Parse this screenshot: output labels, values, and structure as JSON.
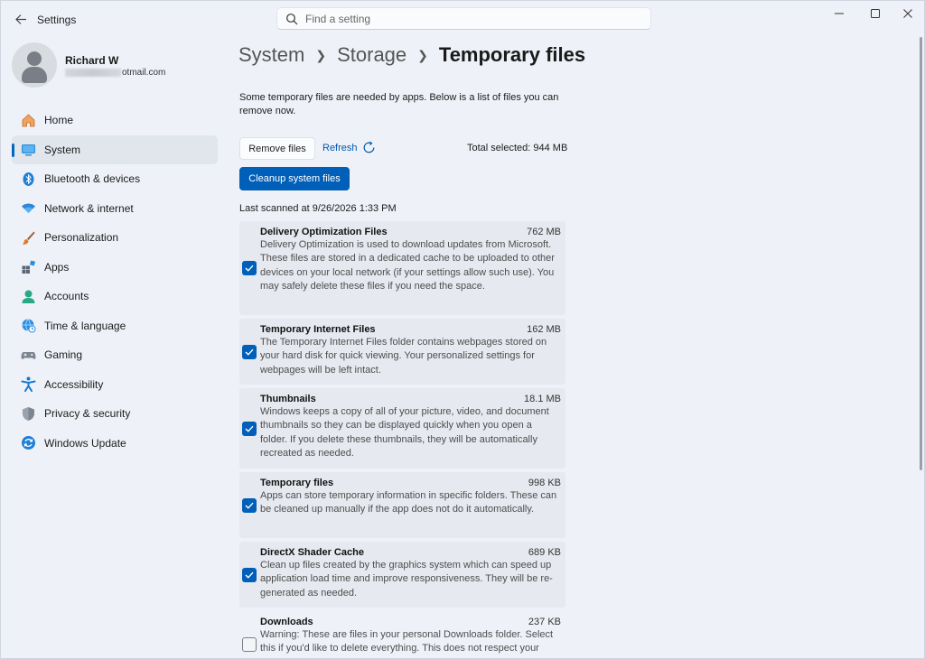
{
  "window": {
    "title": "Settings"
  },
  "search": {
    "placeholder": "Find a setting"
  },
  "user": {
    "name": "Richard W",
    "email_visible": "otmail.com"
  },
  "sidebar": {
    "items": [
      {
        "label": "Home",
        "icon": "home-icon"
      },
      {
        "label": "System",
        "icon": "system-icon",
        "active": true
      },
      {
        "label": "Bluetooth & devices",
        "icon": "bluetooth-icon"
      },
      {
        "label": "Network & internet",
        "icon": "wifi-icon"
      },
      {
        "label": "Personalization",
        "icon": "brush-icon"
      },
      {
        "label": "Apps",
        "icon": "apps-icon"
      },
      {
        "label": "Accounts",
        "icon": "accounts-icon"
      },
      {
        "label": "Time & language",
        "icon": "globe-clock-icon"
      },
      {
        "label": "Gaming",
        "icon": "gamepad-icon"
      },
      {
        "label": "Accessibility",
        "icon": "accessibility-icon"
      },
      {
        "label": "Privacy & security",
        "icon": "shield-icon"
      },
      {
        "label": "Windows Update",
        "icon": "update-icon"
      }
    ]
  },
  "breadcrumb": {
    "part1": "System",
    "part2": "Storage",
    "current": "Temporary files"
  },
  "intro": "Some temporary files are needed by apps. Below is a list of files you can remove now.",
  "actions": {
    "remove_label": "Remove files",
    "refresh_label": "Refresh",
    "total_selected": "Total selected: 944 MB",
    "cleanup_label": "Cleanup system files"
  },
  "last_scanned": "Last scanned at 9/26/2026 1:33 PM",
  "files": [
    {
      "name": "Delivery Optimization Files",
      "size": "762 MB",
      "checked": true,
      "desc": "Delivery Optimization is used to download updates from Microsoft. These files are stored in a dedicated cache to be uploaded to other devices on your local network (if your settings allow such use). You may safely delete these files if you need the space."
    },
    {
      "name": "Temporary Internet Files",
      "size": "162 MB",
      "checked": true,
      "desc": "The Temporary Internet Files folder contains webpages stored on your hard disk for quick viewing. Your personalized settings for webpages will be left intact."
    },
    {
      "name": "Thumbnails",
      "size": "18.1 MB",
      "checked": true,
      "desc": "Windows keeps a copy of all of your picture, video, and document thumbnails so they can be displayed quickly when you open a folder. If you delete these thumbnails, they will be automatically recreated as needed."
    },
    {
      "name": "Temporary files",
      "size": "998 KB",
      "checked": true,
      "desc": "Apps can store temporary information in specific folders. These can be cleaned up manually if the app does not do it automatically."
    },
    {
      "name": "DirectX Shader Cache",
      "size": "689 KB",
      "checked": true,
      "desc": "Clean up files created by the graphics system which can speed up application load time and improve responsiveness. They will be re-generated as needed."
    },
    {
      "name": "Downloads",
      "size": "237 KB",
      "checked": false,
      "desc": "Warning: These are files in your personal Downloads folder. Select this if you'd like to delete everything. This does not respect your"
    }
  ],
  "colors": {
    "accent": "#005fb8",
    "background": "#eef2f8",
    "card": "#e6e9ef"
  }
}
